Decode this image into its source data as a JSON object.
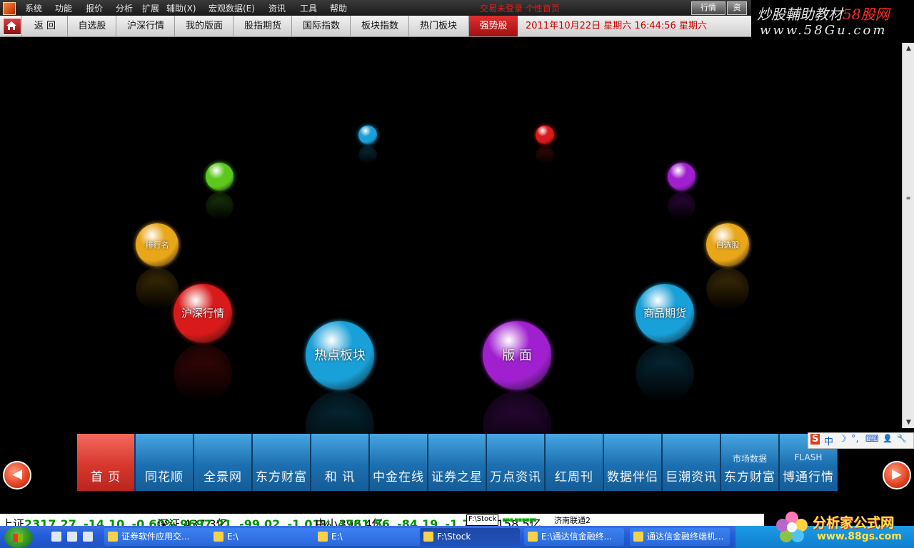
{
  "menubar": {
    "items": [
      "系统",
      "功能",
      "报价",
      "分析",
      "扩展",
      "辅助(X)",
      "宏观数据(E)",
      "资讯",
      "工具",
      "帮助"
    ],
    "center_text": "交易未登录  个性首页",
    "window_buttons": [
      "行情",
      "资"
    ]
  },
  "toolbar": {
    "items": [
      "返 回",
      "自选股",
      "沪深行情",
      "我的版面",
      "股指期货",
      "国际指数",
      "板块指数",
      "热门板块",
      "强势股"
    ],
    "active_index": 8,
    "datetime": "2011年10月22日  星期六  16:44:56 星期六"
  },
  "brand": {
    "title_prefix": "炒股輔助教材",
    "title_suffix": "58股网",
    "url": "www.58Gu.com"
  },
  "bubbles": [
    {
      "label": "",
      "color": "#1aa0d8"
    },
    {
      "label": "",
      "color": "#d81a1a"
    },
    {
      "label": "",
      "color": "#5cc81e"
    },
    {
      "label": "",
      "color": "#a020d0"
    },
    {
      "label": "排行名",
      "color": "#e8a61a"
    },
    {
      "label": "自选股",
      "color": "#e8a61a"
    },
    {
      "label": "沪深行情",
      "color": "#d81a1a"
    },
    {
      "label": "商品期货",
      "color": "#1aa0d8"
    },
    {
      "label": "热点板块",
      "color": "#1aa0d8"
    },
    {
      "label": "版 面",
      "color": "#a020d0"
    }
  ],
  "tiles": [
    {
      "label": "首 页",
      "sub": ""
    },
    {
      "label": "同花顺",
      "sub": ""
    },
    {
      "label": "全景网",
      "sub": ""
    },
    {
      "label": "东方财富",
      "sub": ""
    },
    {
      "label": "和 讯",
      "sub": ""
    },
    {
      "label": "中金在线",
      "sub": ""
    },
    {
      "label": "证券之星",
      "sub": ""
    },
    {
      "label": "万点资讯",
      "sub": ""
    },
    {
      "label": "红周刊",
      "sub": ""
    },
    {
      "label": "数据伴侣",
      "sub": ""
    },
    {
      "label": "巨潮资讯",
      "sub": ""
    },
    {
      "label": "东方财富",
      "sub": "市场数据"
    },
    {
      "label": "博通行情",
      "sub": "FLASH"
    }
  ],
  "ime": {
    "items": [
      "S",
      "中",
      "☽",
      "°,",
      "⌨",
      "👤",
      "🔧"
    ]
  },
  "ticker": {
    "sh": {
      "name": "上证",
      "value": "2317.27",
      "change": "-14.10",
      "pct": "-0.60%",
      "amount": "437.3亿"
    },
    "sz": {
      "name": "深证",
      "value": "9697.21",
      "change": "-99.02",
      "pct": "-1.01%",
      "amount": "398.4亿"
    },
    "zx": {
      "name": "中小",
      "value": "4761.56",
      "change": "-84.19",
      "pct": "-1.74%",
      "amount": "158.5亿"
    },
    "tooltip": "F:\\Stock",
    "network": "济南联通2"
  },
  "taskbar": {
    "tasks": [
      "证券软件应用交...",
      "E:\\",
      "E:\\",
      "F:\\Stock",
      "E:\\通达信金融终...",
      "通达信金融终端机..."
    ],
    "pressed_index": 3
  },
  "watermark": {
    "title": "分析家公式网",
    "url": "www.88gs.com"
  }
}
